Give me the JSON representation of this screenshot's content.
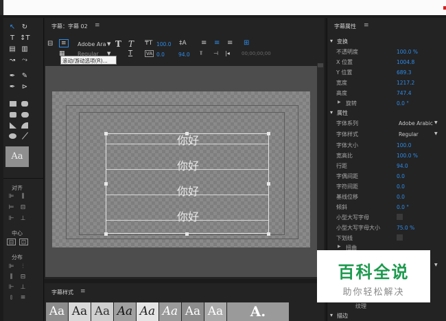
{
  "canvas_panel": {
    "title": "字幕：字幕 02",
    "menu_icon": "hamburger-icon",
    "toolbar": {
      "font_family": "Adobe Ara",
      "font_style": "Regular",
      "leading_value": "100.0",
      "kerning_value": "0.0",
      "tracking_value": "94.0",
      "timecode": "00;00;00;00"
    },
    "tooltip": "滚动/游动选项(R)...",
    "text_lines": [
      "你好",
      "你好",
      "你好",
      "你好"
    ]
  },
  "tools_panel": {
    "sample_text": "Aa",
    "align_label": "对齐",
    "center_label": "中心",
    "distribute_label": "分布"
  },
  "styles_panel": {
    "title": "字幕样式",
    "tiles": [
      "Aa",
      "Aa",
      "Aa",
      "Aa",
      "Aa",
      "Aa",
      "Aa",
      "Aa"
    ]
  },
  "properties_panel": {
    "title": "字幕属性",
    "transform_section": "变换",
    "transform": [
      {
        "label": "不透明度",
        "value": "100.0 %"
      },
      {
        "label": "X 位置",
        "value": "1004.8"
      },
      {
        "label": "Y 位置",
        "value": "689.3"
      },
      {
        "label": "宽度",
        "value": "1217.2"
      },
      {
        "label": "高度",
        "value": "747.4"
      }
    ],
    "rotation": {
      "label": "旋转",
      "value": "0.0 °"
    },
    "props_section": "属性",
    "font_family": {
      "label": "字体系列",
      "value": "Adobe Arabic"
    },
    "font_style": {
      "label": "字体样式",
      "value": "Regular"
    },
    "values": [
      {
        "label": "字体大小",
        "value": "100.0"
      },
      {
        "label": "宽高比",
        "value": "100.0 %"
      },
      {
        "label": "行距",
        "value": "94.0"
      },
      {
        "label": "字偶间距",
        "value": "0.0"
      },
      {
        "label": "字符间距",
        "value": "0.0"
      },
      {
        "label": "基线位移",
        "value": "0.0"
      },
      {
        "label": "倾斜",
        "value": "0.0 °"
      }
    ],
    "small_caps": "小型大写字母",
    "small_caps_size": {
      "label": "小型大写字母大小",
      "value": "75.0 %"
    },
    "underline": "下划线",
    "distort": "扭曲",
    "texture": "纹理",
    "stroke": "描边"
  },
  "watermark": {
    "line1": "百科全说",
    "line2": "助你轻松解决"
  }
}
